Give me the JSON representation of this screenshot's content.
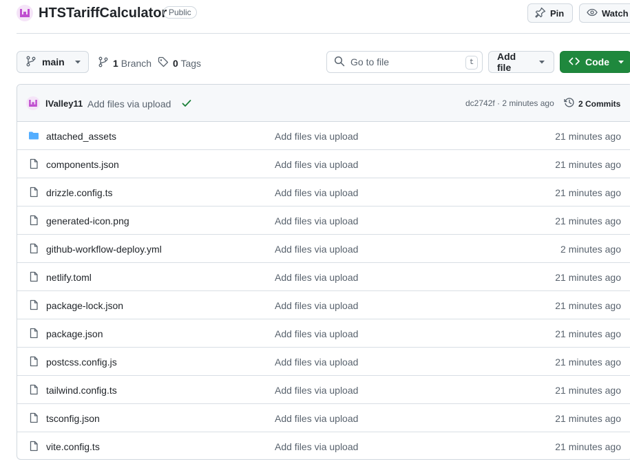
{
  "repo": {
    "name": "HTSTariffCalculator",
    "visibility": "Public",
    "pin_label": "Pin",
    "watch_label": "Watch"
  },
  "toolbar": {
    "branch": "main",
    "branch_count": "1",
    "branch_word": "Branch",
    "tag_count": "0",
    "tag_word": "Tags",
    "search_placeholder": "Go to file",
    "search_shortcut": "t",
    "add_file_label": "Add file",
    "code_label": "Code"
  },
  "commit": {
    "user": "lValley11",
    "message": "Add files via upload",
    "meta": "dc2742f · 2 minutes ago",
    "commits_label": "2 Commits"
  },
  "files": [
    {
      "type": "folder",
      "name": "attached_assets",
      "message": "Add files via upload",
      "time": "21 minutes ago"
    },
    {
      "type": "file",
      "name": "components.json",
      "message": "Add files via upload",
      "time": "21 minutes ago"
    },
    {
      "type": "file",
      "name": "drizzle.config.ts",
      "message": "Add files via upload",
      "time": "21 minutes ago"
    },
    {
      "type": "file",
      "name": "generated-icon.png",
      "message": "Add files via upload",
      "time": "21 minutes ago"
    },
    {
      "type": "file",
      "name": "github-workflow-deploy.yml",
      "message": "Add files via upload",
      "time": "2 minutes ago"
    },
    {
      "type": "file",
      "name": "netlify.toml",
      "message": "Add files via upload",
      "time": "21 minutes ago"
    },
    {
      "type": "file",
      "name": "package-lock.json",
      "message": "Add files via upload",
      "time": "21 minutes ago"
    },
    {
      "type": "file",
      "name": "package.json",
      "message": "Add files via upload",
      "time": "21 minutes ago"
    },
    {
      "type": "file",
      "name": "postcss.config.js",
      "message": "Add files via upload",
      "time": "21 minutes ago"
    },
    {
      "type": "file",
      "name": "tailwind.config.ts",
      "message": "Add files via upload",
      "time": "21 minutes ago"
    },
    {
      "type": "file",
      "name": "tsconfig.json",
      "message": "Add files via upload",
      "time": "21 minutes ago"
    },
    {
      "type": "file",
      "name": "vite.config.ts",
      "message": "Add files via upload",
      "time": "21 minutes ago"
    }
  ],
  "colors": {
    "code_button": "#1f883d",
    "folder_icon": "#54aeff",
    "check": "#1a7f37",
    "avatar": "#c04fd0"
  }
}
